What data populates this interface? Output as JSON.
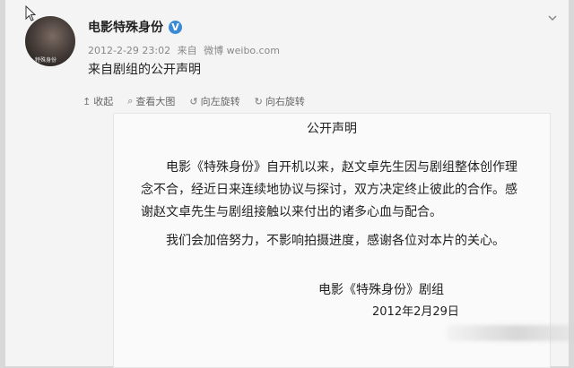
{
  "post": {
    "author": "电影特殊身份",
    "verified_badge": "V",
    "datetime": "2012-2-29 23:02",
    "from_label": "来自",
    "source": "微博 weibo.com",
    "text": "来自剧组的公开声明",
    "avatar_tag": "特殊身份"
  },
  "toolbar": {
    "items": [
      {
        "icon": "collapse-icon",
        "glyph": "↥",
        "label": "收起"
      },
      {
        "icon": "zoom-icon",
        "glyph": "⌕",
        "label": "查看大图"
      },
      {
        "icon": "rotate-left-icon",
        "glyph": "↺",
        "label": "向左旋转"
      },
      {
        "icon": "rotate-right-icon",
        "glyph": "↻",
        "label": "向右旋转"
      }
    ]
  },
  "statement": {
    "title": "公开声明",
    "paragraph1": "电影《特殊身份》自开机以来，赵文卓先生因与剧组整体创作理念不合，经近日来连续地协议与探讨，双方决定终止彼此的合作。感谢赵文卓先生与剧组接触以来付出的诸多心血与配合。",
    "paragraph2": "我们会加倍努力，不影响拍摄进度，感谢各位对本片的关心。",
    "signature": "电影《特殊身份》剧组",
    "date": "2012年2月29日"
  }
}
